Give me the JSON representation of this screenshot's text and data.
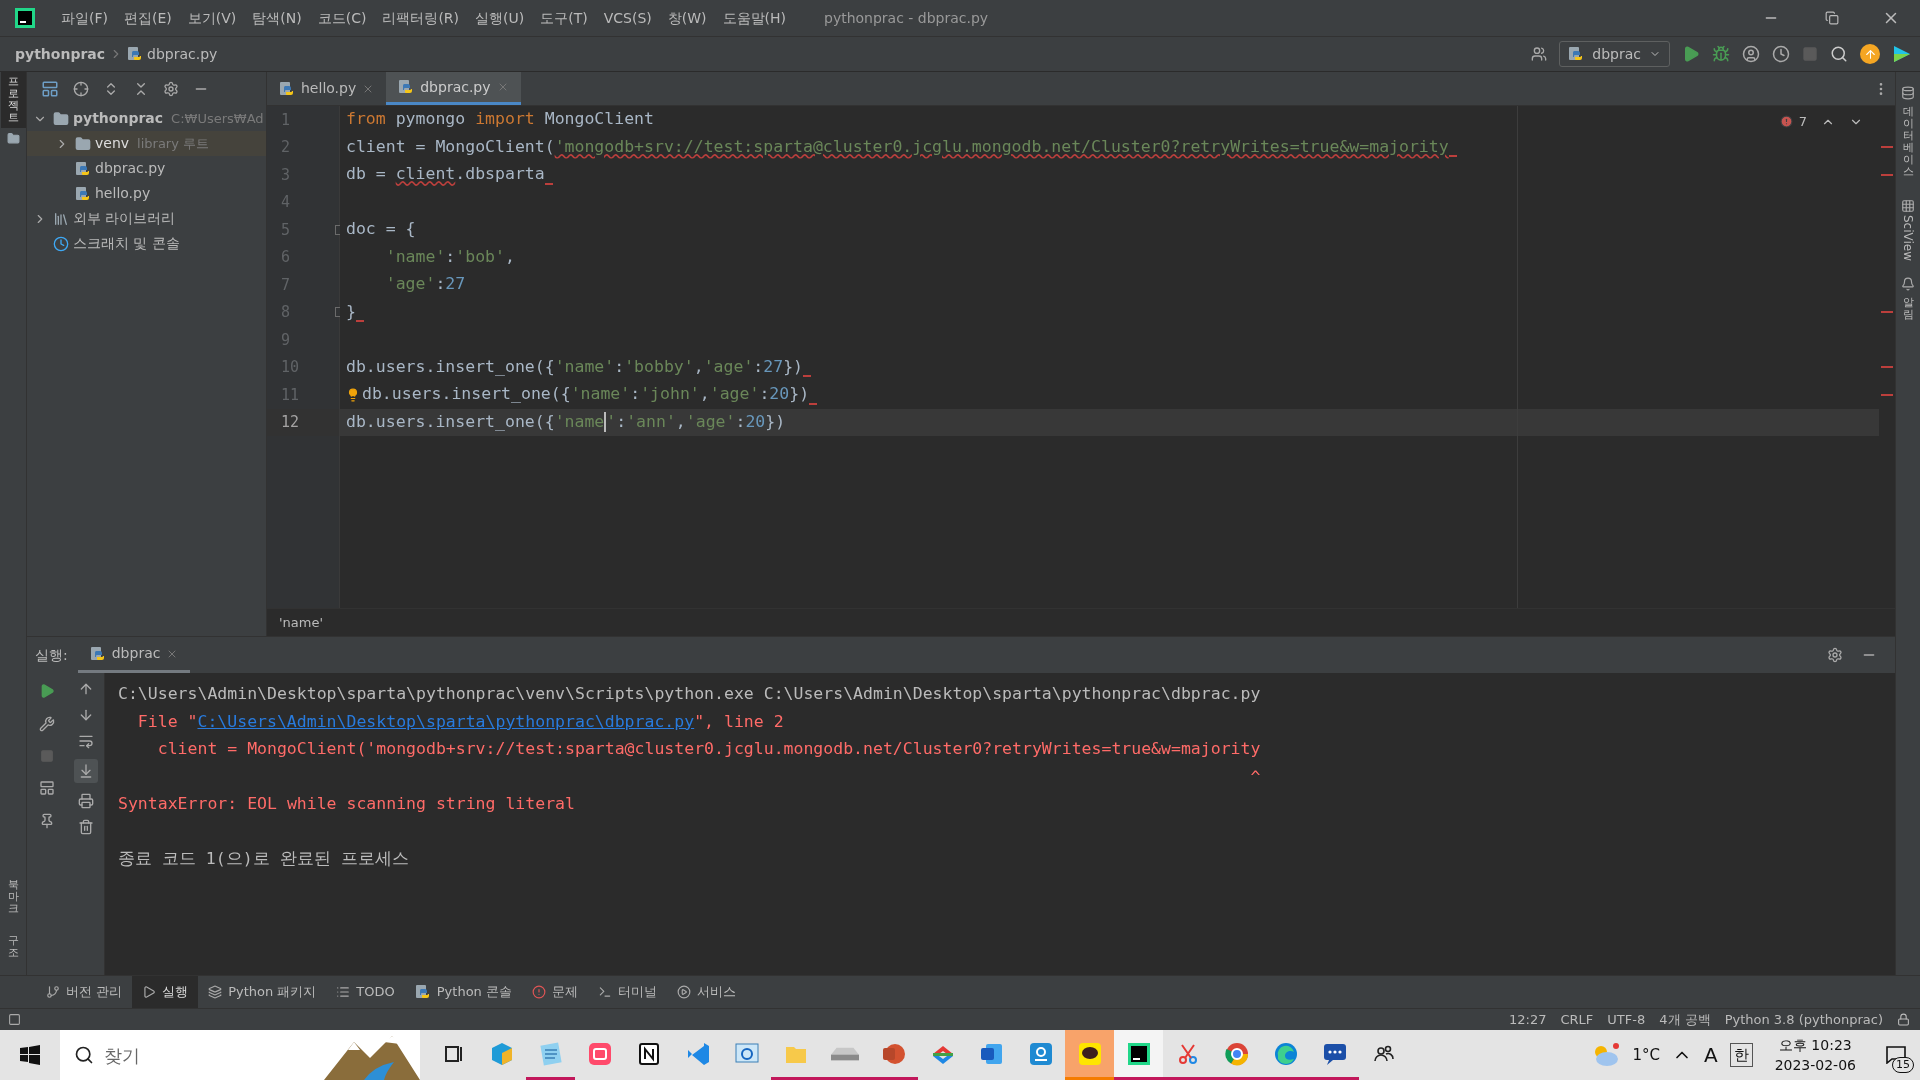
{
  "window": {
    "title": "pythonprac - dbprac.py"
  },
  "menu": [
    "파일(F)",
    "편집(E)",
    "보기(V)",
    "탐색(N)",
    "코드(C)",
    "리팩터링(R)",
    "실행(U)",
    "도구(T)",
    "VCS(S)",
    "창(W)",
    "도움말(H)"
  ],
  "breadcrumb": [
    "pythonprac",
    "dbprac.py"
  ],
  "toolbar": {
    "run_config": "dbprac"
  },
  "left_strip_top": [
    {
      "label": "프로젝트",
      "selected": true
    }
  ],
  "left_strip_bottom": [
    {
      "label": "북마크",
      "selected": false
    },
    {
      "label": "구조",
      "selected": false
    }
  ],
  "right_strip": [
    {
      "label": "데이터베이스",
      "kind": "stacked"
    },
    {
      "label": "SciView",
      "kind": "rotated"
    },
    {
      "label": "알림",
      "kind": "stacked"
    }
  ],
  "project": {
    "items": [
      {
        "label": "pythonprac",
        "note": "C:₩Users₩Ad",
        "kind": "folder",
        "expanded": true,
        "selected": false,
        "children": [
          {
            "label": "venv",
            "note": "library 루트",
            "kind": "folder",
            "expanded": false,
            "selected": true
          },
          {
            "label": "dbprac.py",
            "kind": "python",
            "selected": false
          },
          {
            "label": "hello.py",
            "kind": "python",
            "selected": false
          }
        ]
      },
      {
        "label": "외부 라이브러리",
        "kind": "library",
        "expanded": false,
        "selected": false
      },
      {
        "label": "스크래치 및 콘솔",
        "kind": "scratch",
        "selected": false
      }
    ]
  },
  "tabs": [
    {
      "label": "hello.py",
      "selected": false
    },
    {
      "label": "dbprac.py",
      "selected": true
    }
  ],
  "editor": {
    "error_count": "7",
    "lines": [
      {
        "number": "1",
        "tokens": [
          {
            "text": "from",
            "kind": "keyword"
          },
          {
            "text": " pymongo ",
            "kind": "plain"
          },
          {
            "text": "import",
            "kind": "keyword"
          },
          {
            "text": " MongoClient",
            "kind": "plain"
          }
        ]
      },
      {
        "number": "2",
        "tokens": [
          {
            "text": "client = MongoClient(",
            "kind": "plain"
          },
          {
            "text": "'mongodb+srv://test:sparta@cluster0.jcglu.mongodb.net/Cluster0?retryWrites=true&w=majority",
            "kind": "string",
            "error": true
          }
        ],
        "error_tail": true
      },
      {
        "number": "3",
        "tokens": [
          {
            "text": "db = ",
            "kind": "plain"
          },
          {
            "text": "client",
            "kind": "plain",
            "error": true
          },
          {
            "text": ".dbsparta",
            "kind": "plain"
          }
        ],
        "error_tail": true
      },
      {
        "number": "4"
      },
      {
        "number": "5",
        "tokens": [
          {
            "text": "doc = {",
            "kind": "plain"
          }
        ],
        "fold": true
      },
      {
        "number": "6",
        "indent": true,
        "tokens": [
          {
            "text": "'name'",
            "kind": "string"
          },
          {
            "text": ":",
            "kind": "plain"
          },
          {
            "text": "'bob'",
            "kind": "string"
          },
          {
            "text": ",",
            "kind": "plain"
          }
        ]
      },
      {
        "number": "7",
        "indent": true,
        "tokens": [
          {
            "text": "'age'",
            "kind": "string"
          },
          {
            "text": ":",
            "kind": "plain"
          },
          {
            "text": "27",
            "kind": "number"
          }
        ]
      },
      {
        "number": "8",
        "tokens": [
          {
            "text": "}",
            "kind": "plain"
          }
        ],
        "fold": true,
        "error_tail": true
      },
      {
        "number": "9"
      },
      {
        "number": "10",
        "tokens": [
          {
            "text": "db.users.insert_one({",
            "kind": "plain"
          },
          {
            "text": "'name'",
            "kind": "string"
          },
          {
            "text": ":",
            "kind": "plain"
          },
          {
            "text": "'bobby'",
            "kind": "string"
          },
          {
            "text": ",",
            "kind": "plain"
          },
          {
            "text": "'age'",
            "kind": "string"
          },
          {
            "text": ":",
            "kind": "plain"
          },
          {
            "text": "27",
            "kind": "number"
          },
          {
            "text": "})",
            "kind": "plain"
          }
        ],
        "error_tail": true
      },
      {
        "number": "11",
        "bulb": true,
        "tokens": [
          {
            "text": "db.users.insert_one({",
            "kind": "plain"
          },
          {
            "text": "'name'",
            "kind": "string"
          },
          {
            "text": ":",
            "kind": "plain"
          },
          {
            "text": "'john'",
            "kind": "string"
          },
          {
            "text": ",",
            "kind": "plain"
          },
          {
            "text": "'age'",
            "kind": "string"
          },
          {
            "text": ":",
            "kind": "plain"
          },
          {
            "text": "20",
            "kind": "number"
          },
          {
            "text": "})",
            "kind": "plain"
          }
        ],
        "error_tail": true
      },
      {
        "number": "12",
        "current": true,
        "tokens": [
          {
            "text": "db.users.insert_one({",
            "kind": "plain"
          },
          {
            "text": "'name",
            "kind": "string",
            "caret_after": true
          },
          {
            "text": "'",
            "kind": "string"
          },
          {
            "text": ":",
            "kind": "plain"
          },
          {
            "text": "'ann'",
            "kind": "string"
          },
          {
            "text": ",",
            "kind": "plain"
          },
          {
            "text": "'age'",
            "kind": "string"
          },
          {
            "text": ":",
            "kind": "plain"
          },
          {
            "text": "20",
            "kind": "number"
          },
          {
            "text": "})",
            "kind": "plain"
          }
        ]
      }
    ]
  },
  "editor_breadcrumb": "'name'",
  "run_panel": {
    "label": "실행:",
    "tab": "dbprac",
    "scroll_to_end_on": true,
    "output": [
      {
        "kind": "command",
        "text": "C:\\Users\\Admin\\Desktop\\sparta\\pythonprac\\venv\\Scripts\\python.exe C:\\Users\\Admin\\Desktop\\sparta\\pythonprac\\dbprac.py"
      },
      {
        "kind": "file",
        "prefix": "File \"",
        "link": "C:\\Users\\Admin\\Desktop\\sparta\\pythonprac\\dbprac.py",
        "suffix": "\", line 2"
      },
      {
        "kind": "source",
        "text": "client = MongoClient('mongodb+srv://test:sparta@cluster0.jcglu.mongodb.net/Cluster0?retryWrites=true&w=majority"
      },
      {
        "kind": "caret",
        "text": "^"
      },
      {
        "kind": "error",
        "text": "SyntaxError: EOL while scanning string literal"
      },
      {
        "kind": "blank"
      },
      {
        "kind": "command",
        "text": "종료 코드 1(으)로 완료된 프로세스"
      }
    ]
  },
  "tool_tabs": [
    {
      "label": "버전 관리",
      "kind": "branch",
      "selected": false
    },
    {
      "label": "실행",
      "kind": "play",
      "selected": true
    },
    {
      "label": "Python 패키지",
      "kind": "layers",
      "selected": false
    },
    {
      "label": "TODO",
      "kind": "list",
      "selected": false
    },
    {
      "label": "Python 콘솔",
      "kind": "python",
      "selected": false
    },
    {
      "label": "문제",
      "kind": "alert",
      "selected": false
    },
    {
      "label": "터미널",
      "kind": "terminal",
      "selected": false
    },
    {
      "label": "서비스",
      "kind": "service",
      "selected": false
    }
  ],
  "status_bar": [
    "12:27",
    "CRLF",
    "UTF-8",
    "4개 공백",
    "Python 3.8 (pythonprac)"
  ],
  "taskbar": {
    "search_placeholder": "찾기",
    "apps": [
      {
        "kind": "taskview",
        "running": false,
        "selected": false,
        "flashing": false
      },
      {
        "kind": "cube",
        "running": false,
        "selected": false,
        "flashing": false
      },
      {
        "kind": "notepad",
        "running": true,
        "selected": false,
        "flashing": false
      },
      {
        "kind": "sync",
        "running": false,
        "selected": false,
        "flashing": false
      },
      {
        "kind": "notebook",
        "running": false,
        "selected": false,
        "flashing": false
      },
      {
        "kind": "code",
        "running": false,
        "selected": false,
        "flashing": false
      },
      {
        "kind": "magnifier",
        "running": false,
        "selected": false,
        "flashing": false
      },
      {
        "kind": "folder",
        "running": true,
        "selected": false,
        "flashing": false
      },
      {
        "kind": "drive",
        "running": true,
        "selected": false,
        "flashing": false
      },
      {
        "kind": "slides",
        "running": true,
        "selected": false,
        "flashing": false
      },
      {
        "kind": "colorful",
        "running": false,
        "selected": false,
        "flashing": false
      },
      {
        "kind": "doc",
        "running": false,
        "selected": false,
        "flashing": false
      },
      {
        "kind": "tile",
        "running": false,
        "selected": false,
        "flashing": false
      },
      {
        "kind": "talk",
        "running": true,
        "selected": false,
        "flashing": true
      },
      {
        "kind": "ide",
        "running": true,
        "selected": true,
        "flashing": false
      },
      {
        "kind": "snip",
        "running": true,
        "selected": false,
        "flashing": false
      },
      {
        "kind": "round",
        "running": true,
        "selected": false,
        "flashing": false
      },
      {
        "kind": "wave",
        "running": true,
        "selected": false,
        "flashing": false
      },
      {
        "kind": "chat",
        "running": true,
        "selected": false,
        "flashing": false
      },
      {
        "kind": "people",
        "running": false,
        "selected": false,
        "flashing": false
      }
    ],
    "temperature": "1°C",
    "ime": [
      "A",
      "한"
    ],
    "time": "오후 10:23",
    "date": "2023-02-06",
    "notifications": "15"
  }
}
